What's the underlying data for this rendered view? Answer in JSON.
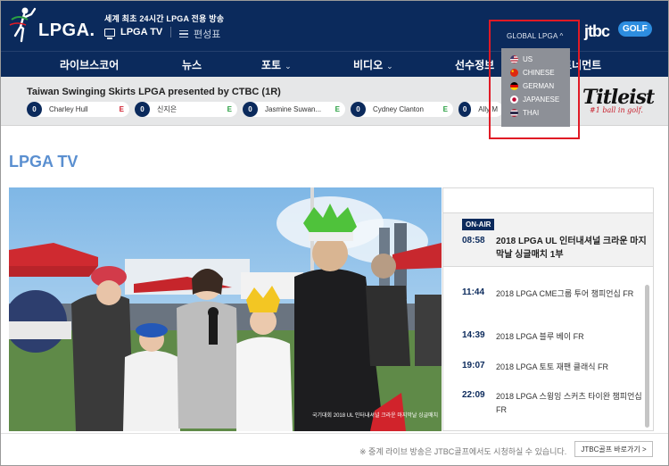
{
  "header": {
    "logo_text": "LPGA.",
    "tagline": "세계 최초 24시간 LPGA 전용 방송",
    "tv_link": "LPGA TV",
    "schedule_link": "편성표",
    "jtbc": "jtbc",
    "golf_badge": "GOLF",
    "global_label": "GLOBAL LPGA ^",
    "global_options": [
      {
        "label": "US",
        "flag": "#b22234"
      },
      {
        "label": "CHINESE",
        "flag": "#de2910"
      },
      {
        "label": "GERMAN",
        "flag": "#dd0000"
      },
      {
        "label": "JAPANESE",
        "flag": "#bc002d"
      },
      {
        "label": "THAI",
        "flag": "#2d2a4a"
      }
    ]
  },
  "nav": {
    "items": [
      {
        "label": "라이브스코어",
        "has_chevron": false
      },
      {
        "label": "뉴스",
        "has_chevron": false
      },
      {
        "label": "포토",
        "has_chevron": true
      },
      {
        "label": "비디오",
        "has_chevron": true
      },
      {
        "label": "선수정보",
        "has_chevron": false
      },
      {
        "label": "토너먼트",
        "has_chevron": false
      }
    ]
  },
  "leaderboard": {
    "title": "Taiwan Swinging Skirts LPGA presented by CTBC (1R)",
    "entries": [
      {
        "pos": "0",
        "name": "Charley Hull",
        "stat": "E",
        "stat_color": "#d01f2e"
      },
      {
        "pos": "0",
        "name": "신지은",
        "stat": "E",
        "stat_color": "#2aa043"
      },
      {
        "pos": "0",
        "name": "Jasmine Suwan...",
        "stat": "E",
        "stat_color": "#2aa043"
      },
      {
        "pos": "0",
        "name": "Cydney Clanton",
        "stat": "E",
        "stat_color": "#2aa043"
      },
      {
        "pos": "0",
        "name": "Ally M",
        "stat": "",
        "stat_color": "#2aa043"
      }
    ],
    "sponsor_brand": "Titleist",
    "sponsor_tag": "#1 ball in golf."
  },
  "page": {
    "title": "LPGA TV"
  },
  "video": {
    "caption": "국기대회 2018 UL 인터내셔널 크라운 마지막날 싱글매치"
  },
  "schedule": {
    "onair_badge": "ON-AIR",
    "onair_time": "08:58",
    "onair_title": "2018 LPGA UL 인터내셔널 크라운 마지막날 싱글매치 1부",
    "items": [
      {
        "time": "11:44",
        "title": "2018 LPGA CME그룹 투어 챔피언십 FR"
      },
      {
        "time": "14:39",
        "title": "2018 LPGA 블루 베이 FR"
      },
      {
        "time": "19:07",
        "title": "2018 LPGA 토토 재팬 클래식 FR"
      },
      {
        "time": "22:09",
        "title": "2018 LPGA 스윙잉 스커츠 타이완 챔피언십 FR"
      }
    ]
  },
  "footer": {
    "note": "※ 중계 라이브 방송은 JTBC골프에서도 시청하실 수 있습니다.",
    "button": "JTBC골프 바로가기 >"
  }
}
